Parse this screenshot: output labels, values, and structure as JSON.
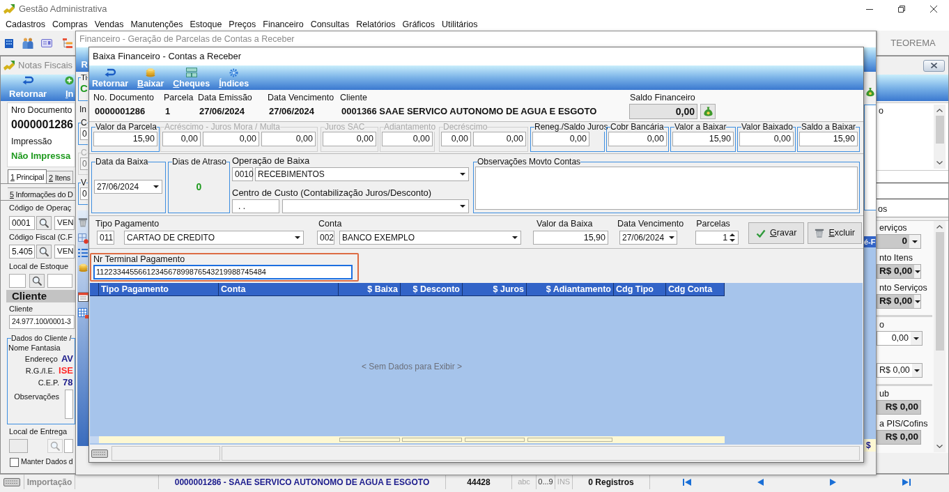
{
  "app": {
    "title": "Gestão Administrativa",
    "menu": [
      "Cadastros",
      "Compras",
      "Vendas",
      "Manutenções",
      "Estoque",
      "Preços",
      "Financeiro",
      "Consultas",
      "Relatórios",
      "Gráficos",
      "Utilitários"
    ],
    "brand": "TEOREMA"
  },
  "notas_fiscais": {
    "title": "Notas Fiscais",
    "toolbar": [
      {
        "label": "Retornar",
        "kind": "return",
        "hotkey": false
      },
      {
        "label": "In",
        "kind": "add",
        "hotkey": true
      }
    ],
    "documento": {
      "label": "Nro Documento",
      "value": "0000001286"
    },
    "impressao": {
      "label": "Impressão",
      "value": "Não Impressa"
    },
    "tabs": [
      {
        "label": "1 Principal",
        "selected": true,
        "hotkey": true
      },
      {
        "label": "2 Itens",
        "selected": false,
        "hotkey": true
      }
    ],
    "tabs_row_2": [
      {
        "label": "5 Informações do D",
        "selected": false,
        "hotkey": true
      }
    ],
    "codigo_operacao": {
      "label": "Código de Operaç",
      "code": "0001",
      "description": "VEN"
    },
    "codigo_fiscal": {
      "label": "Código Fiscal (C.F",
      "code": "5.405",
      "description": "VEN"
    },
    "local_estoque": {
      "label": "Local de Estoque"
    },
    "section": "Cliente",
    "cliente": {
      "label": "Cliente",
      "value": "24.977.100/0001-3"
    },
    "dados_cliente": {
      "title": "Dados do Cliente /",
      "subtitle": "Nome Fantasia",
      "rows": [
        {
          "label": "Endereço",
          "value": "AV",
          "color": "#1c1c8a"
        },
        {
          "label": "R.G./I.E.",
          "value": "ISE",
          "color": "#ff2a2a"
        },
        {
          "label": "C.E.P.",
          "value": "78",
          "color": "#1c1c8a"
        }
      ],
      "observacoes": "Observações"
    },
    "local_entrega": {
      "label": "Local de Entrega"
    },
    "manter_dados": {
      "label": "Manter Dados d",
      "checked": false
    },
    "right_panel": {
      "top_text": "o",
      "tab_text": "os",
      "groups": [
        {
          "items": [
            {
              "label": "erviços",
              "value": "0",
              "kind": "readonly_dropdown"
            },
            {
              "label": "nto Itens",
              "value": "R$ 0,00",
              "kind": "readonly_dropdown"
            },
            {
              "label": "nto Serviços",
              "value": "R$ 0,00",
              "kind": "readonly_dropdown"
            }
          ]
        },
        {
          "items": [
            {
              "label": "o",
              "value": "0,00",
              "kind": "dropdown"
            },
            {
              "value": "R$ 0,00",
              "kind": "dropdown"
            }
          ]
        },
        {
          "items": [
            {
              "label": "ub",
              "value": "R$ 0,00",
              "kind": "readonly"
            },
            {
              "label": "a PIS/Cofins",
              "value": "R$ 0,00",
              "kind": "readonly"
            }
          ]
        }
      ]
    }
  },
  "status_bar": {
    "panel": "Importação",
    "record": "0000001286 - SAAE SERVICO AUTONOMO DE AGUA E ESGOTO",
    "number": "44428",
    "indicators": [
      {
        "label": "abc",
        "on": false
      },
      {
        "label": "0...9",
        "on": true
      },
      {
        "label": "INS",
        "on": false
      }
    ],
    "count": "0 Registros"
  },
  "financeiro": {
    "title": "Financeiro - Geração de Parcelas de Contas a Receber",
    "toolbar_text": "R",
    "status_group": {
      "title": "Ti",
      "value": "C"
    },
    "label": "In",
    "groups": [
      {
        "title": "C",
        "value": "0",
        "disabled": false
      },
      {
        "title": "C",
        "value": "0",
        "disabled": true
      },
      {
        "title": "V",
        "value": "0",
        "disabled": false
      }
    ],
    "grid_header": "é-F",
    "grid_footer": "$"
  },
  "baixa": {
    "title": "Baixa Financeiro - Contas a Receber",
    "toolbar": [
      {
        "label": "Retornar",
        "kind": "return",
        "hotkey": false
      },
      {
        "label": "Baixar",
        "kind": "coins",
        "hotkey": true
      },
      {
        "label": "Cheques",
        "kind": "cheques",
        "hotkey": true
      },
      {
        "label": "Índices",
        "kind": "gear",
        "hotkey": true
      }
    ],
    "header": [
      {
        "label": "No. Documento",
        "value": "0000001286"
      },
      {
        "label": "Parcela",
        "value": "1"
      },
      {
        "label": "Data Emissão",
        "value": "27/06/2024"
      },
      {
        "label": "Data Vencimento",
        "value": "27/06/2024"
      },
      {
        "label": "Cliente",
        "value": "0001366 SAAE SERVICO AUTONOMO DE AGUA E ESGOTO"
      }
    ],
    "saldo": {
      "label": "Saldo Financeiro",
      "value": "0,00"
    },
    "value_groups": [
      {
        "title": "Valor da Parcela",
        "disabled": false,
        "values": [
          "15,90"
        ]
      },
      {
        "title": "Acréscimo - Juros Mora / Multa",
        "disabled": true,
        "values": [
          "0,00",
          "0,00",
          "0,00"
        ]
      },
      {
        "title": "Juros SAC",
        "disabled": true,
        "values": [
          "0,00"
        ]
      },
      {
        "title": "Adiantamento",
        "disabled": true,
        "values": [
          "0,00"
        ]
      },
      {
        "title": "Decréscimo",
        "disabled": true,
        "values": [
          "0,00",
          "0,00"
        ]
      },
      {
        "title": "Reneg./Saldo Juros",
        "disabled": false,
        "values": [
          "0,00"
        ]
      },
      {
        "title": "Cobr Bancária",
        "disabled": false,
        "values": [
          "0,00"
        ]
      },
      {
        "title": "Valor a Baixar",
        "disabled": false,
        "values": [
          "15,90"
        ]
      },
      {
        "title": "Valor Baixado",
        "disabled": false,
        "values": [
          "0,00"
        ]
      },
      {
        "title": "Saldo a Baixar",
        "disabled": false,
        "values": [
          "15,90"
        ]
      }
    ],
    "data_baixa": {
      "title": "Data da Baixa",
      "value": "27/06/2024"
    },
    "dias_atraso": {
      "title": "Dias de Atraso",
      "value": "0"
    },
    "operacao": {
      "label": "Operação de Baixa",
      "code": "0010",
      "value": "RECEBIMENTOS"
    },
    "centro_custo": {
      "label": "Centro de Custo (Contabilização Juros/Desconto)",
      "code": ". ."
    },
    "observacoes": {
      "title": "Observações Movto Contas"
    },
    "pagamento": [
      {
        "label": "Tipo Pagamento",
        "code": "011",
        "value": "CARTAO DE CREDITO",
        "kind": "coded_dropdown"
      },
      {
        "label": "Conta",
        "code": "002",
        "value": "BANCO EXEMPLO",
        "kind": "coded_dropdown"
      },
      {
        "label": "Valor da Baixa",
        "value": "15,90",
        "kind": "amount"
      },
      {
        "label": "Data Vencimento",
        "value": "27/06/2024",
        "kind": "date"
      },
      {
        "label": "Parcelas",
        "value": "1",
        "kind": "spinner"
      }
    ],
    "buttons": [
      {
        "label": "Gravar",
        "kind": "save",
        "hotkey": true
      },
      {
        "label": "Excluir",
        "kind": "delete",
        "hotkey": true
      }
    ],
    "terminal": {
      "label": "Nr Terminal Pagamento",
      "value": "1122334455661234567899876543219988745484"
    },
    "table": {
      "columns": [
        {
          "label": "Tipo Pagamento",
          "kind": "text"
        },
        {
          "label": "Conta",
          "kind": "text"
        },
        {
          "label": "$ Baixa",
          "kind": "money"
        },
        {
          "label": "$ Desconto",
          "kind": "money"
        },
        {
          "label": "$ Juros",
          "kind": "money"
        },
        {
          "label": "$ Adiantamento",
          "kind": "money"
        },
        {
          "label": "Cdg Tipo",
          "kind": "text"
        },
        {
          "label": "Cdg Conta",
          "kind": "text"
        }
      ],
      "empty_message": "< Sem Dados para Exibir >"
    }
  }
}
